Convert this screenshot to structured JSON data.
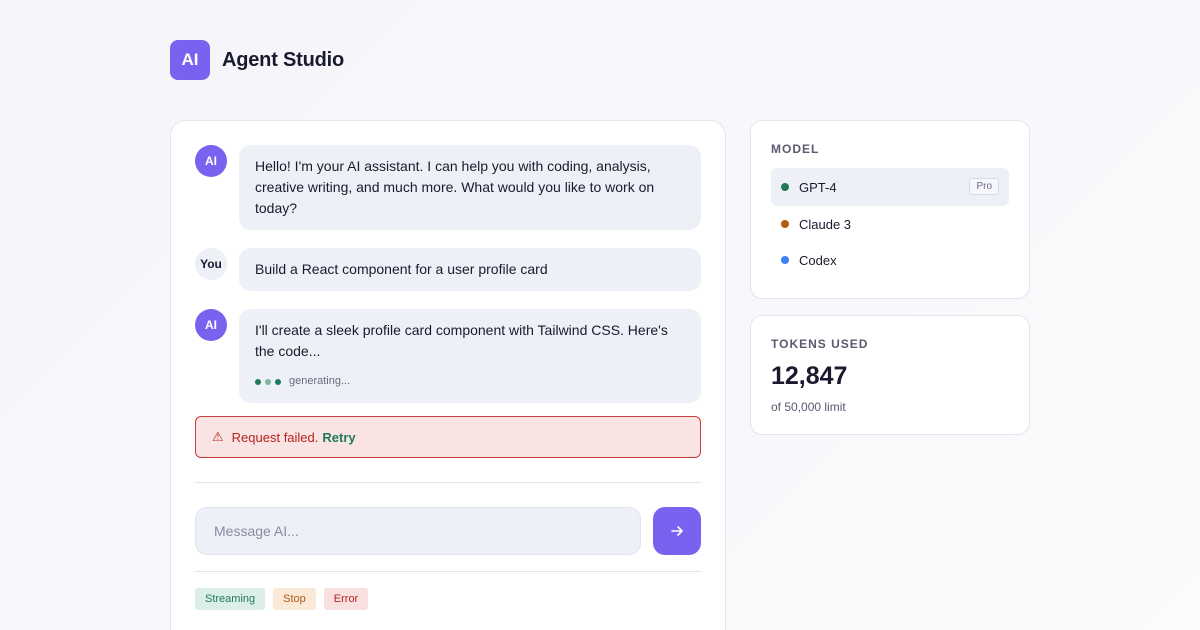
{
  "app": {
    "logo_text": "AI",
    "title": "Agent Studio",
    "brand_color": "#7b61f0"
  },
  "chat": {
    "messages": [
      {
        "role": "ai",
        "avatar": "AI",
        "text": "Hello! I'm your AI assistant. I can help you with coding, analysis, creative writing, and much more. What would you like to work on today?"
      },
      {
        "role": "user",
        "avatar": "You",
        "text": "Build a React component for a user profile card"
      },
      {
        "role": "ai",
        "avatar": "AI",
        "text": "I'll create a sleek profile card component with Tailwind CSS. Here's the code...",
        "status": "generating..."
      }
    ],
    "error": {
      "icon": "warning-icon",
      "message": "Request failed.",
      "action": "Retry"
    },
    "input": {
      "placeholder": "Message AI...",
      "value": ""
    },
    "send_icon": "arrow-right-icon",
    "tags": [
      {
        "label": "Streaming",
        "color": "#1f7a5c"
      },
      {
        "label": "Stop",
        "color": "#b05a12"
      },
      {
        "label": "Error",
        "color": "#b3261e"
      }
    ]
  },
  "model_panel": {
    "label": "MODEL",
    "models": [
      {
        "name": "GPT-4",
        "color": "#1f7a5c",
        "selected": true,
        "badge": "Pro"
      },
      {
        "name": "Claude 3",
        "color": "#b05a12",
        "selected": false
      },
      {
        "name": "Codex",
        "color": "#3b82f6",
        "selected": false
      }
    ]
  },
  "tokens_panel": {
    "label": "TOKENS USED",
    "value": "12,847",
    "limit_text": "of 50,000 limit"
  }
}
